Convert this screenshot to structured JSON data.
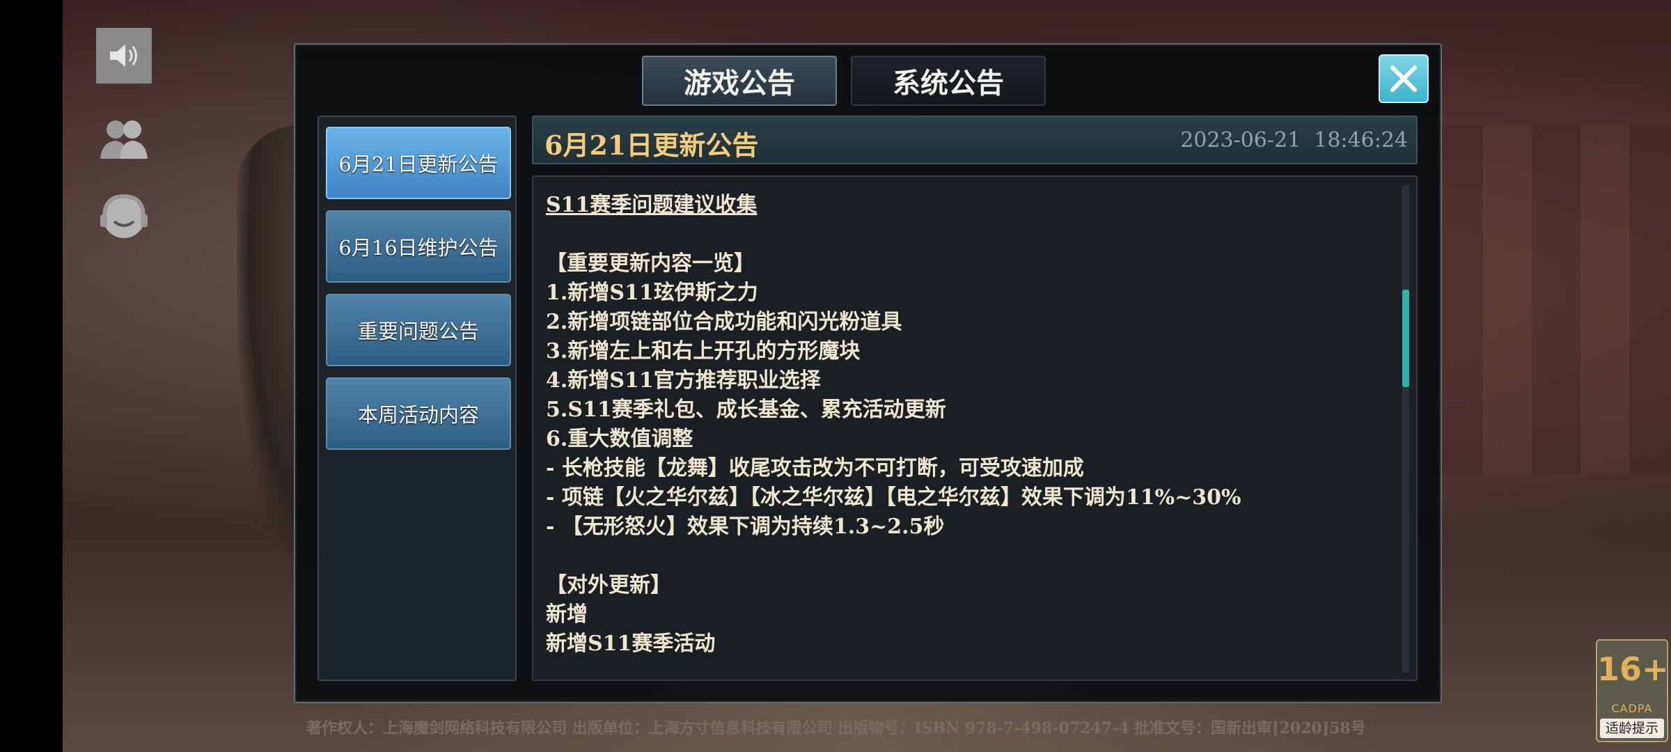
{
  "tabs": [
    {
      "label": "游戏公告",
      "active": true
    },
    {
      "label": "系统公告",
      "active": false
    }
  ],
  "nav": [
    {
      "label": "6月21日更新公告",
      "active": true
    },
    {
      "label": "6月16日维护公告",
      "active": false
    },
    {
      "label": "重要问题公告",
      "active": false
    },
    {
      "label": "本周活动内容",
      "active": false
    }
  ],
  "announcement": {
    "title": "6月21日更新公告",
    "datetime": "2023-06-21  18:46:24",
    "lines": [
      "S11赛季问题建议收集",
      "",
      "【重要更新内容一览】",
      "1.新增S11玹伊斯之力",
      "2.新增项链部位合成功能和闪光粉道具",
      "3.新增左上和右上开孔的方形魔块",
      "4.新增S11官方推荐职业选择",
      "5.S11赛季礼包、成长基金、累充活动更新",
      "6.重大数值调整",
      "- 长枪技能【龙舞】收尾攻击改为不可打断，可受攻速加成",
      "- 项链【火之华尔兹】【冰之华尔兹】【电之华尔兹】效果下调为11%~30%",
      "- 【无形怒火】效果下调为持续1.3~2.5秒",
      "",
      "【对外更新】",
      "新增",
      "新增S11赛季活动"
    ]
  },
  "footer": {
    "copyright": "著作权人：上海魔剑网络科技有限公司 出版单位：上海方寸信息科技有限公司 出版物号：ISBN 978-7-498-07247-4 批准文号：国新出审[2020]58号"
  },
  "age_rating": {
    "rating": "16+",
    "org": "CADPA",
    "tip": "适龄提示"
  },
  "icons": [
    "sound-icon",
    "people-icon",
    "support-icon",
    "close-icon"
  ]
}
